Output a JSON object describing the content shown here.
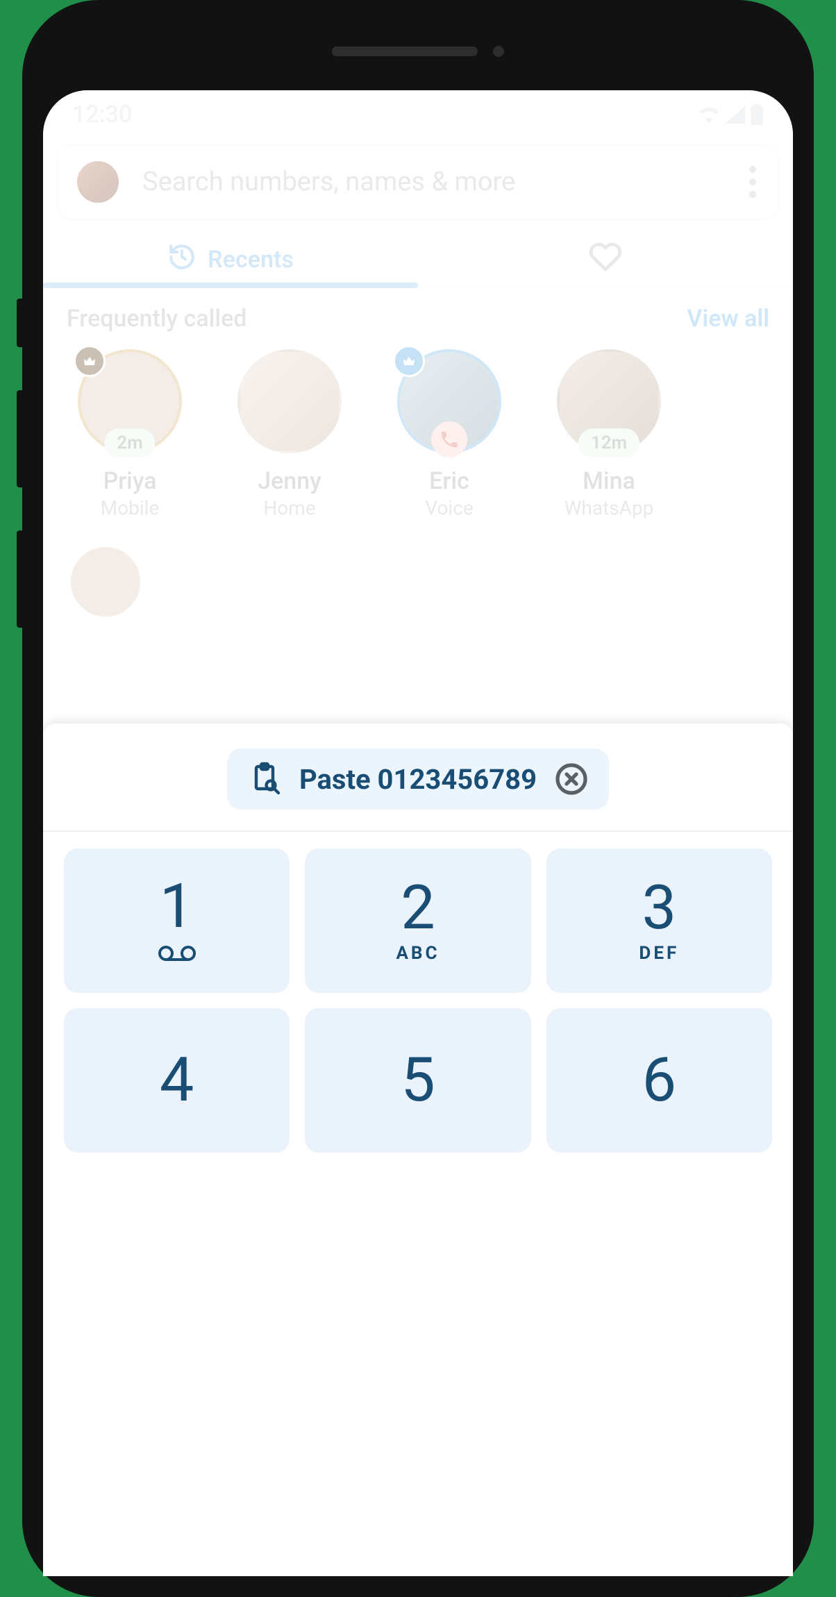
{
  "status": {
    "time": "12:30"
  },
  "search": {
    "placeholder": "Search numbers, names & more"
  },
  "tabs": {
    "recents": "Recents"
  },
  "section": {
    "title": "Frequently called",
    "view_all": "View all"
  },
  "frequent": [
    {
      "name": "Priya",
      "sub": "Mobile",
      "badge_time": "2m",
      "crown": "gold"
    },
    {
      "name": "Jenny",
      "sub": "Home"
    },
    {
      "name": "Eric",
      "sub": "Voice",
      "crown": "blue",
      "call_badge": true
    },
    {
      "name": "Mina",
      "sub": "WhatsApp",
      "badge_time": "12m"
    }
  ],
  "paste": {
    "label": "Paste 0123456789"
  },
  "keypad": [
    {
      "digit": "1",
      "sub_icon": "voicemail"
    },
    {
      "digit": "2",
      "sub": "ABC"
    },
    {
      "digit": "3",
      "sub": "DEF"
    },
    {
      "digit": "4"
    },
    {
      "digit": "5"
    },
    {
      "digit": "6"
    }
  ]
}
